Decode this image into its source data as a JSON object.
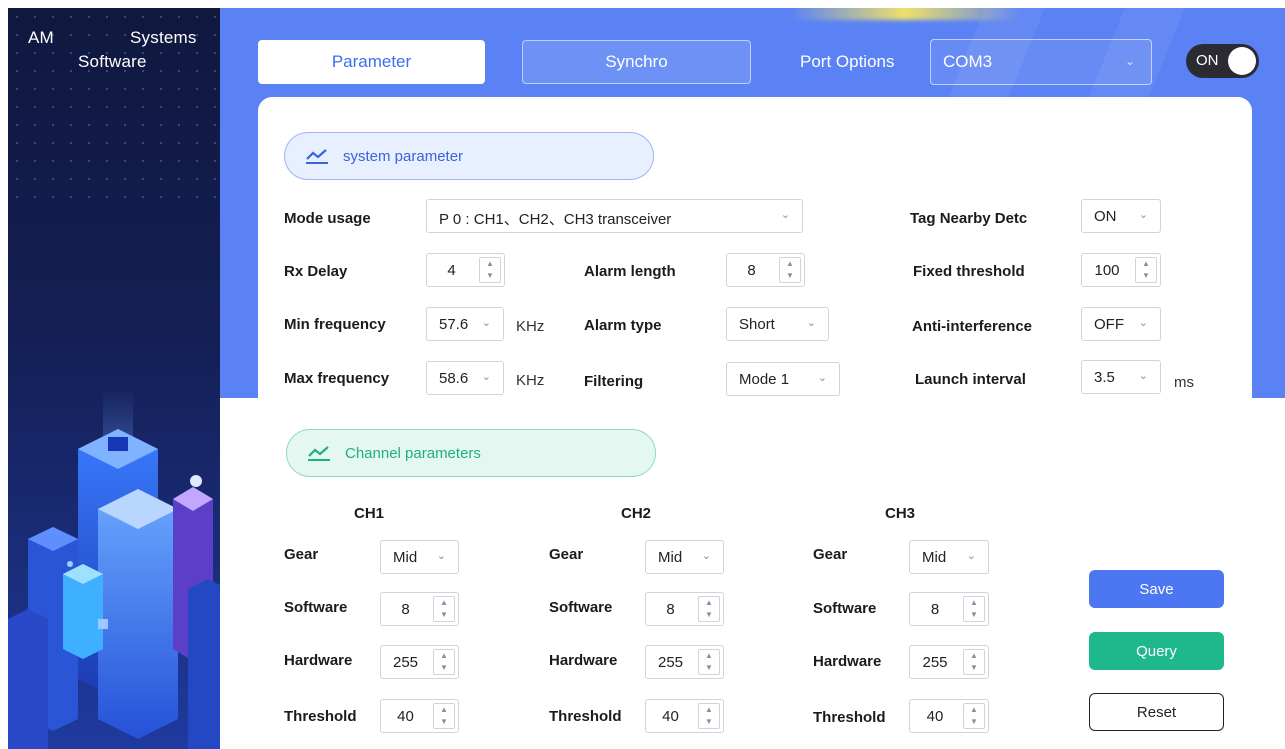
{
  "brand": {
    "line1a": "AM",
    "line1b": "Systems",
    "line2": "Software"
  },
  "tabs": {
    "parameter": "Parameter",
    "synchro": "Synchro"
  },
  "port": {
    "label": "Port Options",
    "value": "COM3",
    "chevron": "⌄"
  },
  "power": {
    "label": "ON"
  },
  "sections": {
    "system": "system parameter",
    "channel": "Channel parameters"
  },
  "system": {
    "mode_usage": {
      "label": "Mode usage",
      "value": "P 0 : CH1、CH2、CH3 transceiver"
    },
    "rx_delay": {
      "label": "Rx Delay",
      "value": "4"
    },
    "min_frequency": {
      "label": "Min  frequency",
      "value": "57.6",
      "unit": "KHz"
    },
    "max_frequency": {
      "label": "Max frequency",
      "value": "58.6",
      "unit": "KHz"
    },
    "alarm_length": {
      "label": "Alarm length",
      "value": "8"
    },
    "alarm_type": {
      "label": "Alarm type",
      "value": "Short"
    },
    "filtering": {
      "label": "Filtering",
      "value": "Mode 1"
    },
    "tag_nearby": {
      "label": "Tag Nearby Detc",
      "value": "ON"
    },
    "fixed_threshold": {
      "label": "Fixed threshold",
      "value": "100"
    },
    "anti_interference": {
      "label": "Anti-interference",
      "value": "OFF"
    },
    "launch_interval": {
      "label": "Launch interval",
      "value": "3.5",
      "unit": "ms"
    }
  },
  "channels": [
    {
      "name": "CH1",
      "gear": "Mid",
      "software": "8",
      "hardware": "255",
      "threshold": "40"
    },
    {
      "name": "CH2",
      "gear": "Mid",
      "software": "8",
      "hardware": "255",
      "threshold": "40"
    },
    {
      "name": "CH3",
      "gear": "Mid",
      "software": "8",
      "hardware": "255",
      "threshold": "40"
    }
  ],
  "channel_labels": {
    "gear": "Gear",
    "software": "Software",
    "hardware": "Hardware",
    "threshold": "Threshold"
  },
  "actions": {
    "save": "Save",
    "query": "Query",
    "reset": "Reset"
  },
  "colors": {
    "accent": "#5b82f5",
    "query": "#1fb88d",
    "sidebar": "#141f55"
  },
  "icons": {
    "chevron": "⌄",
    "spin_up": "▲",
    "spin_down": "▼",
    "section": "trend-icon"
  }
}
